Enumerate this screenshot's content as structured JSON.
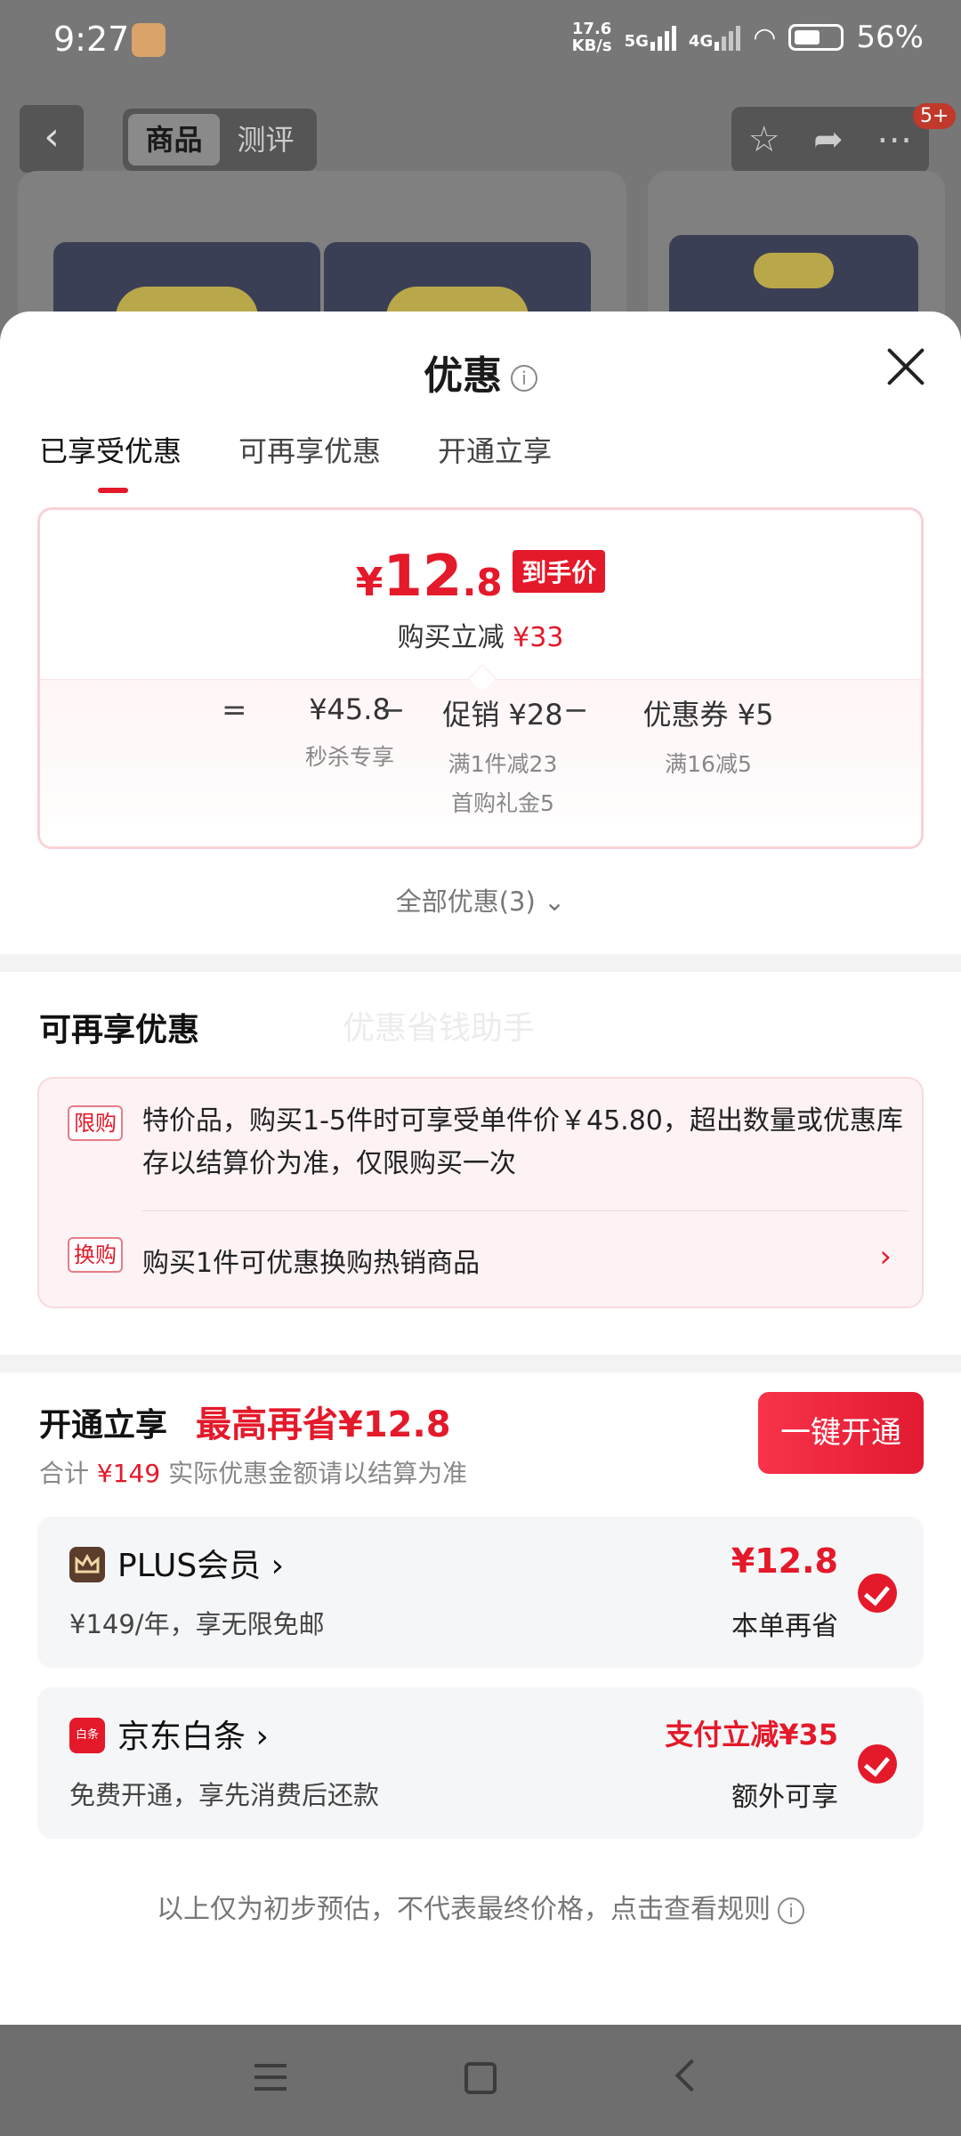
{
  "status_bar": {
    "time": "9:27",
    "net_speed_value": "17.6",
    "net_speed_unit": "KB/s",
    "sig1": "5G",
    "sig2": "4G",
    "battery": "56%"
  },
  "top_nav": {
    "tab_goods": "商品",
    "tab_review": "测评",
    "badge": "5+"
  },
  "sheet": {
    "title": "优惠",
    "tabs": [
      "已享受优惠",
      "可再享优惠",
      "开通立享"
    ],
    "final_price": {
      "currency": "¥",
      "int": "12",
      "dec": ".8",
      "tag": "到手价"
    },
    "save_label": "购买立减",
    "save_amount": "¥33",
    "breakdown": {
      "eq": "=",
      "minus": "−",
      "base_price": "¥45.8",
      "base_sub": "秒杀专享",
      "promo": "促销 ¥28",
      "promo_sub1": "满1件减23",
      "promo_sub2": "首购礼金5",
      "coupon": "优惠券 ¥5",
      "coupon_sub": "满16减5"
    },
    "all_discounts": "全部优惠(3)",
    "more_title": "可再享优惠",
    "watermark": "优惠省钱助手",
    "limit_tag": "限购",
    "limit_text": "特价品，购买1-5件时可享受单件价￥45.80，超出数量或优惠库存以结算价为准，仅限购买一次",
    "swap_tag": "换购",
    "swap_text": "购买1件可优惠换购热销商品",
    "open": {
      "title": "开通立享",
      "max_save": "最高再省¥12.8",
      "sub_prefix": "合计",
      "sub_amount": "¥149",
      "sub_suffix": "实际优惠金额请以结算为准",
      "button": "一键开通"
    },
    "members": [
      {
        "name": "PLUS会员 ›",
        "desc": "¥149/年，享无限免邮",
        "value": "¥12.8",
        "note": "本单再省",
        "icon": "crown-icon",
        "color": "#5a3d2a"
      },
      {
        "name": "京东白条 ›",
        "desc": "免费开通，享先消费后还款",
        "value": "支付立减¥35",
        "note": "额外可享",
        "icon": "baitiao-icon",
        "color": "#e4192a"
      }
    ],
    "footnote": "以上仅为初步预估，不代表最终价格，点击查看规则"
  },
  "colors": {
    "accent": "#e4192a"
  }
}
